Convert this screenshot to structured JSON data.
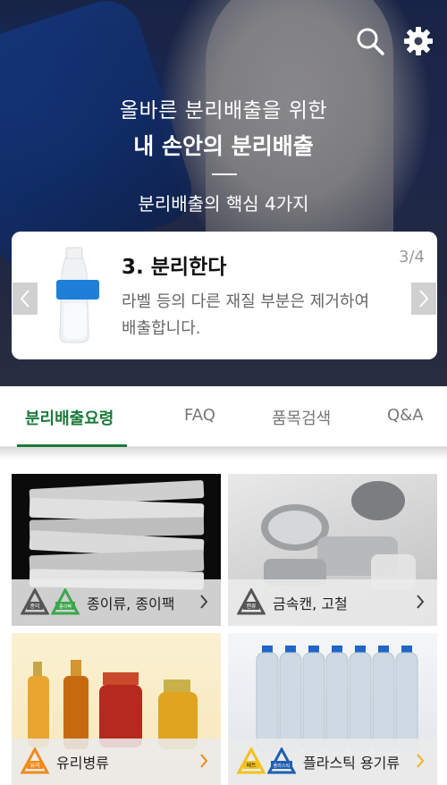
{
  "hero": {
    "subtitle": "올바른 분리배출을 위한",
    "title": "내 손안의 분리배출",
    "core_label": "분리배출의 핵심 4가지",
    "search_icon": "search-icon",
    "settings_icon": "gear-icon"
  },
  "card": {
    "title": "3. 분리한다",
    "counter": "3/4",
    "description_line1": "라벨 등의 다른 재질 부분은 제거하여",
    "description_line2": "배출합니다.",
    "prev_icon": "chevron-left-icon",
    "next_icon": "chevron-right-icon"
  },
  "tabs": [
    {
      "label": "분리배출요령",
      "active": true
    },
    {
      "label": "FAQ",
      "active": false
    },
    {
      "label": "품목검색",
      "active": false
    },
    {
      "label": "Q&A",
      "active": false
    }
  ],
  "categories": [
    {
      "label": "종이류, 종이팩",
      "badges": [
        "종이",
        "종이팩"
      ],
      "chevron_color": "#444444"
    },
    {
      "label": "금속캔, 고철",
      "badges": [
        "캔류"
      ],
      "chevron_color": "#444444"
    },
    {
      "label": "유리병류",
      "badges": [
        "유리"
      ],
      "chevron_color": "#f08a1c"
    },
    {
      "label": "플라스틱 용기류",
      "badges": [
        "페트",
        "플라스틱"
      ],
      "chevron_color": "#f0b21c"
    }
  ],
  "colors": {
    "accent_green": "#1a7a3a",
    "badge_gray": "#555555",
    "badge_green": "#3aa84a",
    "badge_orange": "#f08a1c",
    "badge_yellow": "#f2c21a",
    "badge_blue": "#1f5fb0"
  }
}
